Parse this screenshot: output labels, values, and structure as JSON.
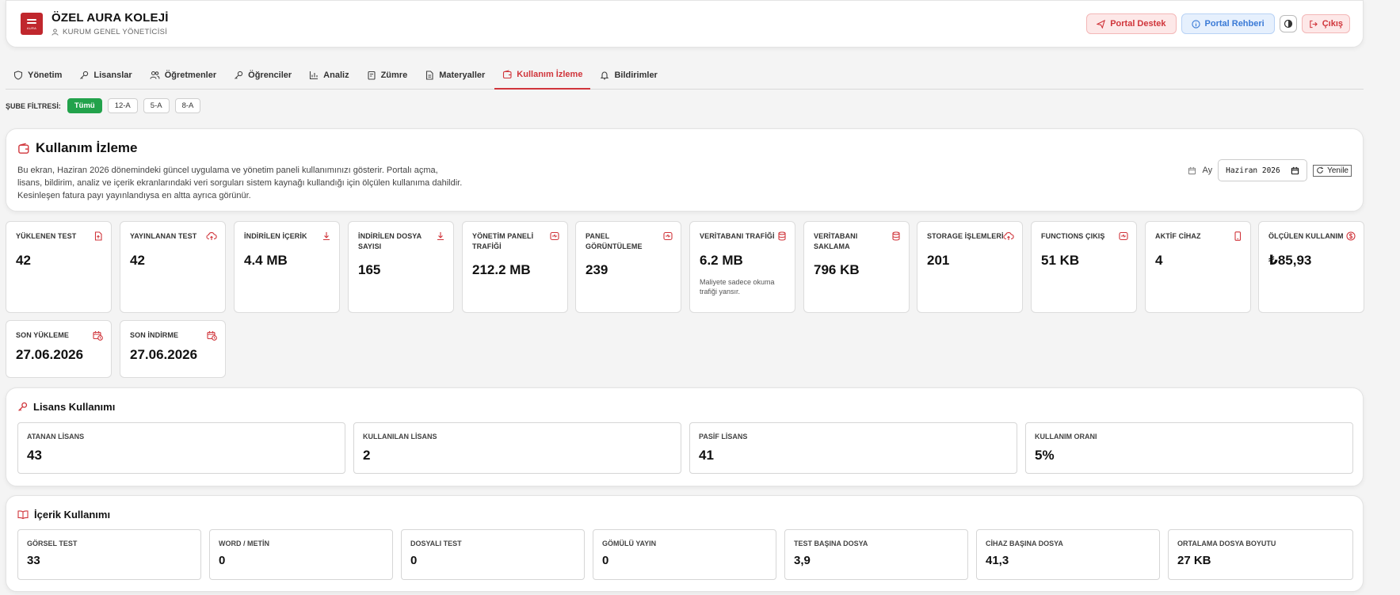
{
  "header": {
    "school_name": "ÖZEL AURA KOLEJİ",
    "role": "KURUM GENEL YÖNETİCİSİ",
    "logo_text": "AURA",
    "support_label": "Portal Destek",
    "guide_label": "Portal Rehberi",
    "exit_label": "Çıkış"
  },
  "tabs": [
    {
      "label": "Yönetim"
    },
    {
      "label": "Lisanslar"
    },
    {
      "label": "Öğretmenler"
    },
    {
      "label": "Öğrenciler"
    },
    {
      "label": "Analiz"
    },
    {
      "label": "Zümre"
    },
    {
      "label": "Materyaller"
    },
    {
      "label": "Kullanım İzleme"
    },
    {
      "label": "Bildirimler"
    }
  ],
  "filter": {
    "label": "ŞUBE FİLTRESİ:",
    "options": [
      "Tümü",
      "12-A",
      "5-A",
      "8-A"
    ]
  },
  "intro": {
    "title": "Kullanım İzleme",
    "desc_line1": "Bu ekran, Haziran 2026 dönemindeki güncel uygulama ve yönetim paneli kullanımınızı gösterir. Portalı açma,",
    "desc_line2": "lisans, bildirim, analiz ve içerik ekranlarındaki veri sorguları sistem kaynağı kullandığı için ölçülen kullanıma dahildir.",
    "desc_line3": "Kesinleşen fatura payı yayınlandıysa en altta ayrıca görünür.",
    "month_label": "Ay",
    "month_value": "Haziran 2026",
    "refresh_label": "Yenile"
  },
  "stats": [
    {
      "label": "YÜKLENEN TEST",
      "value": "42"
    },
    {
      "label": "YAYINLANAN TEST",
      "value": "42"
    },
    {
      "label": "İNDİRİLEN İÇERİK",
      "value": "4.4 MB"
    },
    {
      "label": "İNDİRİLEN DOSYA SAYISI",
      "value": "165"
    },
    {
      "label": "YÖNETİM PANELİ TRAFİĞİ",
      "value": "212.2 MB"
    },
    {
      "label": "PANEL GÖRÜNTÜLEME",
      "value": "239"
    },
    {
      "label": "VERİTABANI TRAFİĞİ",
      "value": "6.2 MB",
      "note": "Maliyete sadece okuma trafiği yansır."
    },
    {
      "label": "VERİTABANI SAKLAMA",
      "value": "796 KB"
    },
    {
      "label": "STORAGE İŞLEMLERİ",
      "value": "201"
    },
    {
      "label": "FUNCTIONS ÇIKIŞ",
      "value": "51 KB"
    },
    {
      "label": "AKTİF CİHAZ",
      "value": "4"
    },
    {
      "label": "ÖLÇÜLEN KULLANIM",
      "value": "₺85,93"
    },
    {
      "label": "SON YÜKLEME",
      "value": "27.06.2026"
    },
    {
      "label": "SON İNDİRME",
      "value": "27.06.2026"
    }
  ],
  "license": {
    "title": "Lisans Kullanımı",
    "metrics": [
      {
        "label": "ATANAN LİSANS",
        "value": "43"
      },
      {
        "label": "KULLANILAN LİSANS",
        "value": "2"
      },
      {
        "label": "PASİF LİSANS",
        "value": "41"
      },
      {
        "label": "KULLANIM ORANI",
        "value": "5%"
      }
    ]
  },
  "content": {
    "title": "İçerik Kullanımı",
    "metrics": [
      {
        "label": "GÖRSEL TEST",
        "value": "33"
      },
      {
        "label": "WORD / METİN",
        "value": "0"
      },
      {
        "label": "DOSYALI TEST",
        "value": "0"
      },
      {
        "label": "GÖMÜLÜ YAYIN",
        "value": "0"
      },
      {
        "label": "TEST BAŞINA DOSYA",
        "value": "3,9"
      },
      {
        "label": "CİHAZ BAŞINA DOSYA",
        "value": "41,3"
      },
      {
        "label": "ORTALAMA DOSYA BOYUTU",
        "value": "27 KB"
      }
    ]
  },
  "colors": {
    "accent": "#d0353b",
    "active_chip": "#22a24b",
    "guide": "#3a7ad6"
  }
}
